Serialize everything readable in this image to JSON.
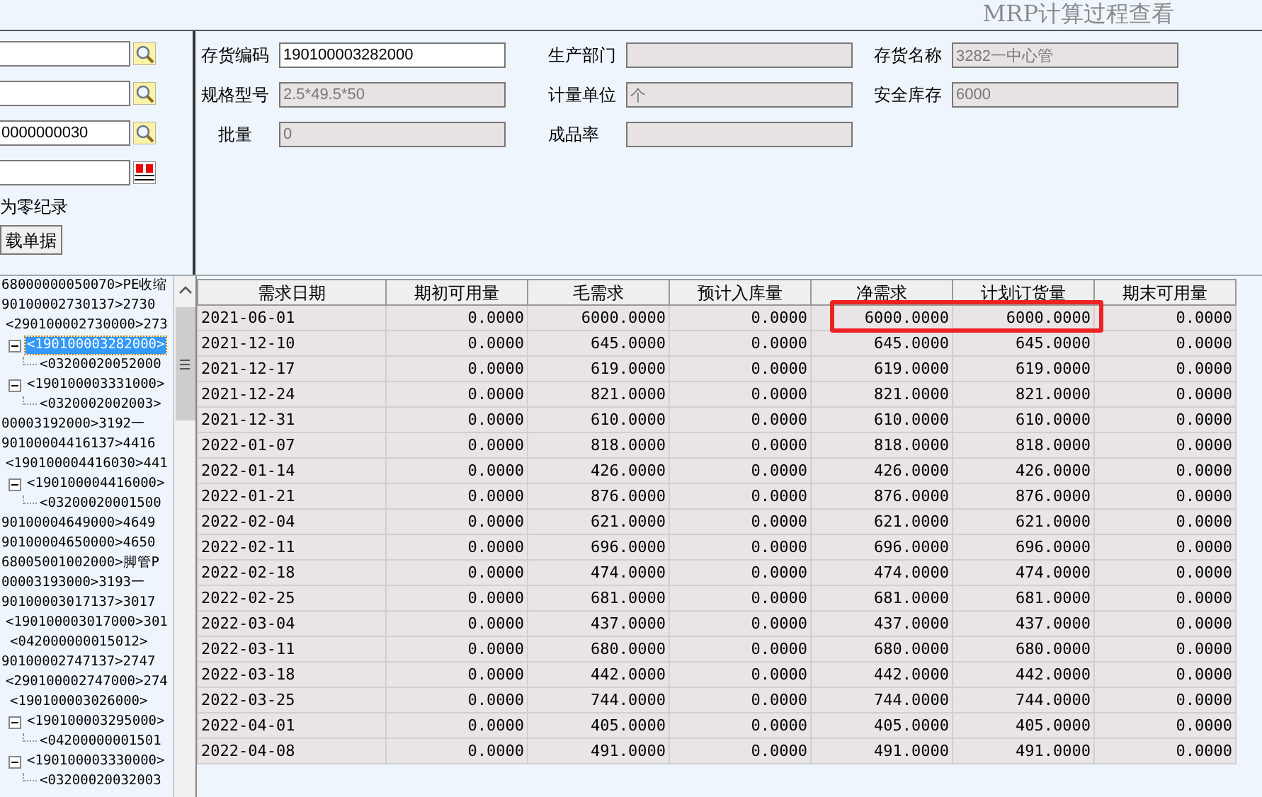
{
  "window": {
    "title": "MRP计算过程查看"
  },
  "filter_panel": {
    "fields": [
      {
        "kind": "lookup"
      },
      {
        "kind": "lookup"
      },
      {
        "value": "0000000030",
        "kind": "lookup"
      },
      {
        "kind": "date"
      }
    ],
    "checkbox_label": "为零纪录",
    "button": "载单据"
  },
  "item_info": {
    "fields": [
      {
        "label": "存货编码",
        "value": "190100003282000",
        "disabled": false
      },
      {
        "label": "生产部门",
        "disabled": true
      },
      {
        "label": "存货名称",
        "value": "3282一中心管",
        "disabled": true
      },
      {
        "label": "规格型号",
        "value": "2.5*49.5*50",
        "disabled": true
      },
      {
        "label": "计量单位",
        "value": "个",
        "disabled": true
      },
      {
        "label": "安全库存",
        "value": "6000",
        "disabled": true
      },
      {
        "label": "批量",
        "value": "0",
        "disabled": true
      },
      {
        "label": "成品率",
        "disabled": true
      }
    ]
  },
  "tree": [
    {
      "label": "68000000050070>PE收缩",
      "selected": false
    },
    {
      "label": "90100002730137>2730",
      "selected": false,
      "children": [
        {
          "label": "<290100002730000>273",
          "selected": false,
          "children": [
            {
              "label": "<190100003282000>",
              "selected": true,
              "expanded": true,
              "children": [
                {
                  "label": "<03200020052000",
                  "selected": false
                }
              ]
            },
            {
              "label": "<190100003331000>",
              "selected": false,
              "expanded": true,
              "children": [
                {
                  "label": "<0320002002003>",
                  "selected": false
                }
              ]
            }
          ]
        }
      ]
    },
    {
      "label": "00003192000>3192一",
      "selected": false
    },
    {
      "label": "90100004416137>4416",
      "selected": false,
      "children": [
        {
          "label": "<190100004416030>441",
          "selected": false,
          "children": [
            {
              "label": "<190100004416000>",
              "selected": false,
              "expanded": true,
              "children": [
                {
                  "label": "<03200020001500",
                  "selected": false
                }
              ]
            }
          ]
        }
      ]
    },
    {
      "label": "90100004649000>4649",
      "selected": false
    },
    {
      "label": "90100004650000>4650",
      "selected": false
    },
    {
      "label": "68005001002000>脚管P",
      "selected": false
    },
    {
      "label": "00003193000>3193一",
      "selected": false
    },
    {
      "label": "90100003017137>3017",
      "selected": false,
      "children": [
        {
          "label": "<190100003017000>301",
          "selected": false,
          "children": [
            {
              "label": "<042000000015012>",
              "selected": false
            }
          ]
        }
      ]
    },
    {
      "label": "90100002747137>2747",
      "selected": false,
      "children": [
        {
          "label": "<290100002747000>274",
          "selected": false,
          "children": [
            {
              "label": "<190100003026000>",
              "selected": false
            },
            {
              "label": "<190100003295000>",
              "selected": false,
              "expanded": true,
              "children": [
                {
                  "label": "<04200000001501",
                  "selected": false
                }
              ]
            },
            {
              "label": "<190100003330000>",
              "selected": false,
              "expanded": true,
              "children": [
                {
                  "label": "<03200020032003",
                  "selected": false
                }
              ]
            }
          ]
        }
      ]
    }
  ],
  "table": {
    "columns": [
      "需求日期",
      "期初可用量",
      "毛需求",
      "预计入库量",
      "净需求",
      "计划订货量",
      "期末可用量"
    ],
    "rows": [
      [
        "2021-06-01",
        "0.0000",
        "6000.0000",
        "0.0000",
        "6000.0000",
        "6000.0000",
        "0.0000"
      ],
      [
        "2021-12-10",
        "0.0000",
        "645.0000",
        "0.0000",
        "645.0000",
        "645.0000",
        "0.0000"
      ],
      [
        "2021-12-17",
        "0.0000",
        "619.0000",
        "0.0000",
        "619.0000",
        "619.0000",
        "0.0000"
      ],
      [
        "2021-12-24",
        "0.0000",
        "821.0000",
        "0.0000",
        "821.0000",
        "821.0000",
        "0.0000"
      ],
      [
        "2021-12-31",
        "0.0000",
        "610.0000",
        "0.0000",
        "610.0000",
        "610.0000",
        "0.0000"
      ],
      [
        "2022-01-07",
        "0.0000",
        "818.0000",
        "0.0000",
        "818.0000",
        "818.0000",
        "0.0000"
      ],
      [
        "2022-01-14",
        "0.0000",
        "426.0000",
        "0.0000",
        "426.0000",
        "426.0000",
        "0.0000"
      ],
      [
        "2022-01-21",
        "0.0000",
        "876.0000",
        "0.0000",
        "876.0000",
        "876.0000",
        "0.0000"
      ],
      [
        "2022-02-04",
        "0.0000",
        "621.0000",
        "0.0000",
        "621.0000",
        "621.0000",
        "0.0000"
      ],
      [
        "2022-02-11",
        "0.0000",
        "696.0000",
        "0.0000",
        "696.0000",
        "696.0000",
        "0.0000"
      ],
      [
        "2022-02-18",
        "0.0000",
        "474.0000",
        "0.0000",
        "474.0000",
        "474.0000",
        "0.0000"
      ],
      [
        "2022-02-25",
        "0.0000",
        "681.0000",
        "0.0000",
        "681.0000",
        "681.0000",
        "0.0000"
      ],
      [
        "2022-03-04",
        "0.0000",
        "437.0000",
        "0.0000",
        "437.0000",
        "437.0000",
        "0.0000"
      ],
      [
        "2022-03-11",
        "0.0000",
        "680.0000",
        "0.0000",
        "680.0000",
        "680.0000",
        "0.0000"
      ],
      [
        "2022-03-18",
        "0.0000",
        "442.0000",
        "0.0000",
        "442.0000",
        "442.0000",
        "0.0000"
      ],
      [
        "2022-03-25",
        "0.0000",
        "744.0000",
        "0.0000",
        "744.0000",
        "744.0000",
        "0.0000"
      ],
      [
        "2022-04-01",
        "0.0000",
        "405.0000",
        "0.0000",
        "405.0000",
        "405.0000",
        "0.0000"
      ],
      [
        "2022-04-08",
        "0.0000",
        "491.0000",
        "0.0000",
        "491.0000",
        "491.0000",
        "0.0000"
      ]
    ]
  }
}
